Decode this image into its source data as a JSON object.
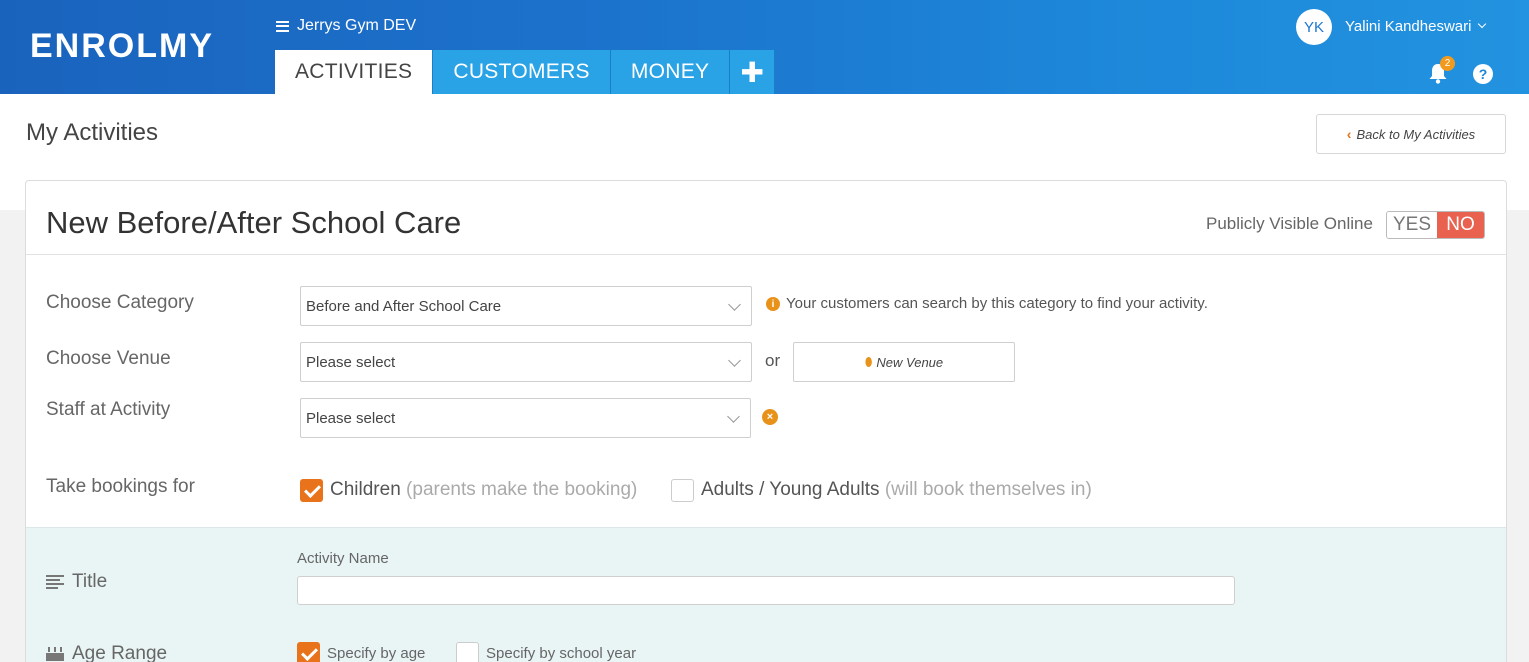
{
  "app": {
    "logo": "ENROLMY",
    "org_name": "Jerrys Gym DEV",
    "user_initials": "YK",
    "user_name": "Yalini Kandheswari",
    "notification_count": "2",
    "help_label": "?",
    "colors": {
      "header": "#1d76cf",
      "accent": "#e8731a",
      "no_active": "#e8624f",
      "tab": "#2aa3e6"
    }
  },
  "nav": {
    "tabs": [
      {
        "label": "ACTIVITIES",
        "active": true
      },
      {
        "label": "CUSTOMERS",
        "active": false
      },
      {
        "label": "MONEY",
        "active": false
      }
    ],
    "plus_label": "✚"
  },
  "page": {
    "title": "My Activities",
    "back_label": "Back to My Activities"
  },
  "form": {
    "title": "New Before/After School Care",
    "visibility_label": "Publicly Visible Online",
    "yes_label": "YES",
    "no_label": "NO",
    "visible_value": "NO",
    "category_label": "Choose Category",
    "category_value": "Before and After School Care",
    "category_info": "Your customers can search by this category to find your activity.",
    "venue_label": "Choose Venue",
    "venue_value": "Please select",
    "or_label": "or",
    "new_venue_label": "New Venue",
    "staff_label": "Staff at Activity",
    "staff_value": "Please select",
    "bookings_label": "Take bookings for",
    "children_label": "Children",
    "children_hint": "(parents make the booking)",
    "children_checked": true,
    "adults_label": "Adults / Young Adults",
    "adults_hint": "(will book themselves in)",
    "adults_checked": false
  },
  "details": {
    "title_section_label": "Title",
    "activity_name_label": "Activity Name",
    "activity_name_value": "",
    "age_section_label": "Age Range",
    "by_age_label": "Specify by age",
    "by_age_checked": true,
    "by_school_year_label": "Specify by school year",
    "by_school_year_checked": false
  }
}
